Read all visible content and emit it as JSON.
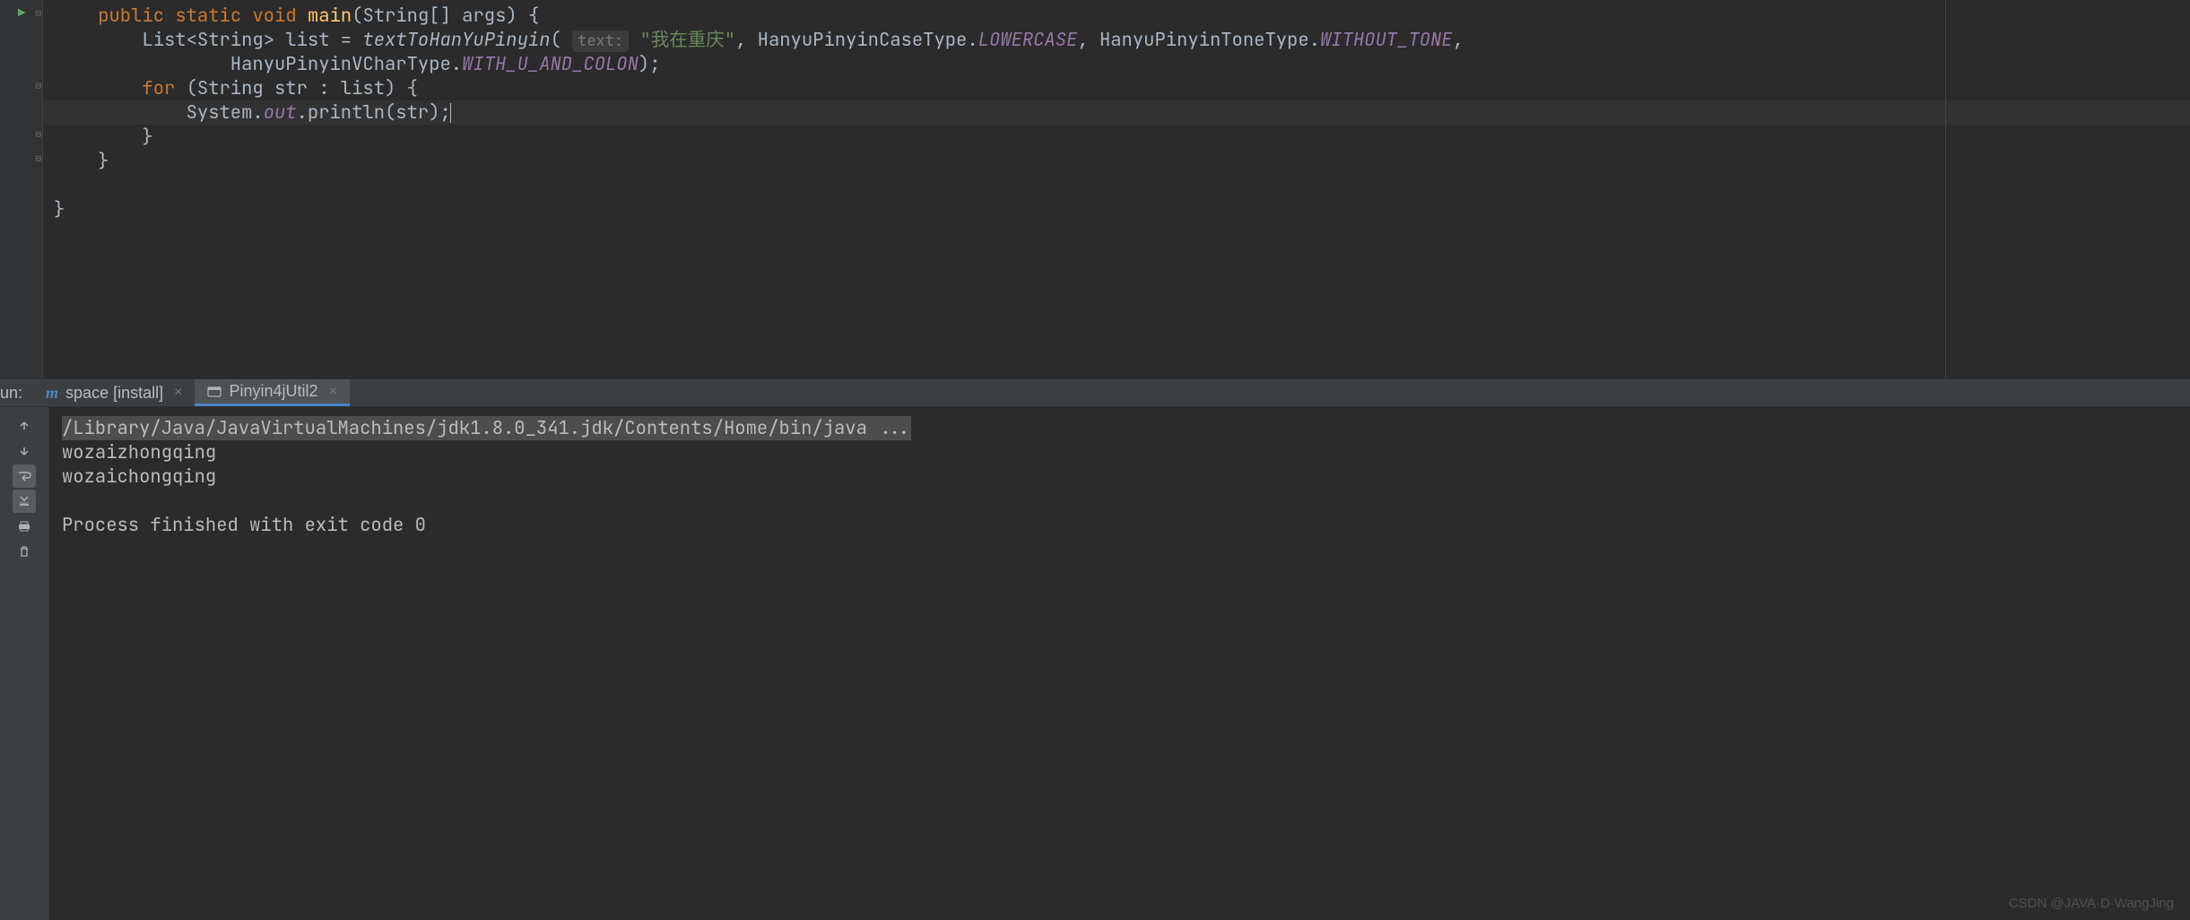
{
  "editor": {
    "lines": {
      "l1_kw1": "public",
      "l1_kw2": "static",
      "l1_kw3": "void",
      "l1_method": "main",
      "l1_rest": "(String[] args) {",
      "l2_pre": "        List<String> list = ",
      "l2_call": "textToHanYuPinyin",
      "l2_hint": "text:",
      "l2_str": "\"我在重庆\"",
      "l2_c1": ", HanyuPinyinCaseType.",
      "l2_e1": "LOWERCASE",
      "l2_c2": ", HanyuPinyinToneType.",
      "l2_e2": "WITHOUT_TONE",
      "l2_end": ",",
      "l3_pre": "                HanyuPinyinVCharType.",
      "l3_e1": "WITH_U_AND_COLON",
      "l3_end": ");",
      "l4_kw": "for",
      "l4_rest": " (String str : list) {",
      "l5_pre": "            System.",
      "l5_out": "out",
      "l5_rest": ".println(str);",
      "l6": "        }",
      "l7": "    }",
      "l8": "",
      "l9": "}"
    }
  },
  "run": {
    "label": "un:",
    "tab1": "space [install]",
    "tab2": "Pinyin4jUtil2",
    "console": {
      "cmd": "/Library/Java/JavaVirtualMachines/jdk1.8.0_341.jdk/Contents/Home/bin/java ...",
      "out1": "wozaizhongqing",
      "out2": "wozaichongqing",
      "exit": "Process finished with exit code 0"
    }
  },
  "watermark": "CSDN @JAVA·D·WangJing"
}
